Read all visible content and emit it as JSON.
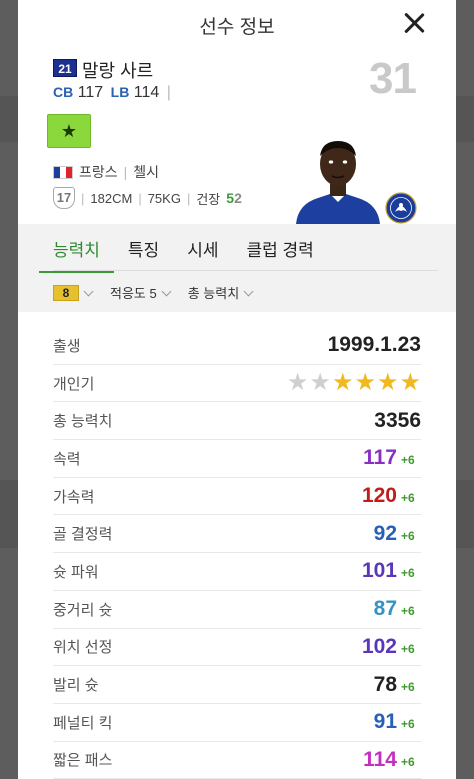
{
  "header": {
    "title": "선수 정보"
  },
  "player": {
    "season_badge": "21",
    "name": "말랑 사르",
    "overall": "31",
    "positions": [
      {
        "pos": "CB",
        "value": "117"
      },
      {
        "pos": "LB",
        "value": "114"
      }
    ],
    "nation": "프랑스",
    "club": "첼시",
    "shield_number": "17",
    "height": "182CM",
    "weight": "75KG",
    "health_label": "건장",
    "left_foot": "5",
    "right_foot": "2",
    "enhance_level": "8"
  },
  "tabs": [
    {
      "label": "능력치",
      "active": true
    },
    {
      "label": "특징",
      "active": false
    },
    {
      "label": "시세",
      "active": false
    },
    {
      "label": "클럽 경력",
      "active": false
    }
  ],
  "filters": {
    "enhance": "8",
    "adaptability": "적응도 5",
    "total_stats": "총 능력치"
  },
  "attributes": [
    {
      "label": "출생",
      "value": "1999.1.23",
      "bonus": "",
      "color": "#222222"
    },
    {
      "label": "개인기",
      "stars_on": 4,
      "stars_total": 6
    },
    {
      "label": "총 능력치",
      "value": "3356",
      "bonus": "",
      "color": "#222222"
    },
    {
      "label": "속력",
      "value": "117",
      "bonus": "+6",
      "color": "#8a2fc2"
    },
    {
      "label": "가속력",
      "value": "120",
      "bonus": "+6",
      "color": "#c01c1c"
    },
    {
      "label": "골 결정력",
      "value": "92",
      "bonus": "+6",
      "color": "#2860b8"
    },
    {
      "label": "슛 파워",
      "value": "101",
      "bonus": "+6",
      "color": "#5a36b8"
    },
    {
      "label": "중거리 슛",
      "value": "87",
      "bonus": "+6",
      "color": "#3593c4"
    },
    {
      "label": "위치 선정",
      "value": "102",
      "bonus": "+6",
      "color": "#5a36b8"
    },
    {
      "label": "발리 슛",
      "value": "78",
      "bonus": "+6",
      "color": "#222222"
    },
    {
      "label": "페널티 킥",
      "value": "91",
      "bonus": "+6",
      "color": "#2860b8"
    },
    {
      "label": "짧은 패스",
      "value": "114",
      "bonus": "+6",
      "color": "#c42fc0"
    }
  ],
  "icons": [
    "close-icon",
    "star-icon",
    "france-flag-icon",
    "shield-icon",
    "health-icon",
    "player-photo",
    "chelsea-crest-icon",
    "chevron-down-icon"
  ]
}
